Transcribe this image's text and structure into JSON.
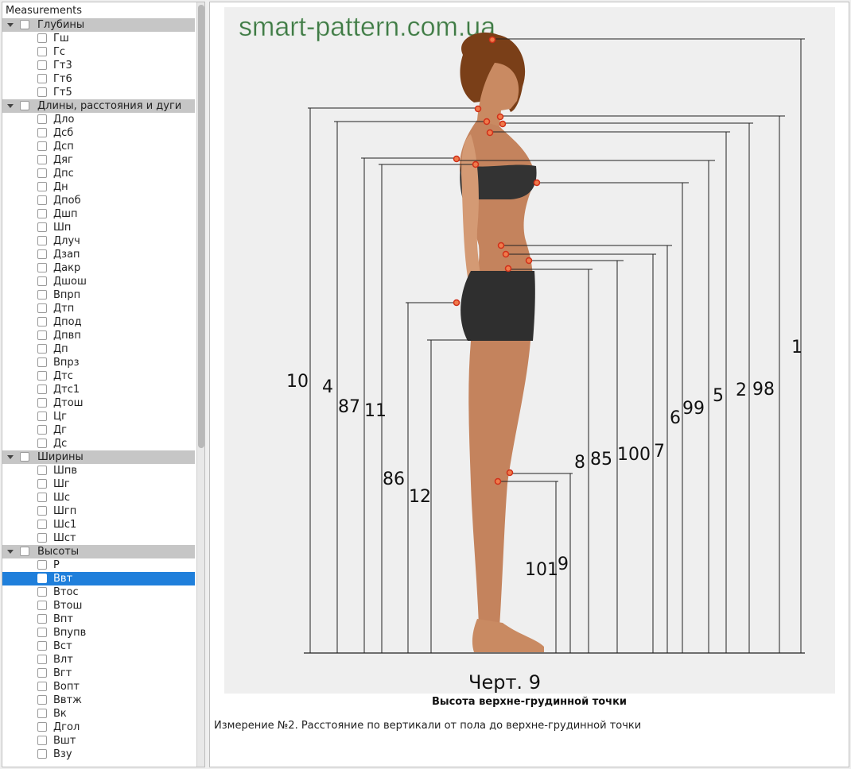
{
  "tree": {
    "header": "Measurements",
    "groups": [
      {
        "label": "Глубины",
        "items": [
          "Гш",
          "Гс",
          "Гт3",
          "Гт6",
          "Гт5"
        ]
      },
      {
        "label": "Длины, расстояния и дуги",
        "items": [
          "Дло",
          "Дсб",
          "Дсп",
          "Дяг",
          "Дпс",
          "Дн",
          "Дпоб",
          "Дшп",
          "Шп",
          "Длуч",
          "Дзап",
          "Дакр",
          "Дшош",
          "Впрп",
          "Дтп",
          "Дпод",
          "Дпвп",
          "Дп",
          "Впрз",
          "Дтс",
          "Дтс1",
          "Дтош",
          "Цг",
          "Дг",
          "Дс"
        ]
      },
      {
        "label": "Ширины",
        "items": [
          "Шпв",
          "Шг",
          "Шс",
          "Шгп",
          "Шс1",
          "Шст"
        ]
      },
      {
        "label": "Высоты",
        "items": [
          "Р",
          "Ввт",
          "Втос",
          "Втош",
          "Впт",
          "Впупв",
          "Вст",
          "Влт",
          "Вгт",
          "Вопт",
          "Ввтж",
          "Вк",
          "Дгол",
          "Вшт",
          "Взу"
        ]
      }
    ],
    "selected": "Ввт"
  },
  "figure": {
    "watermark": "smart-pattern.com.ua",
    "chart_label": "Черт. 9",
    "numbers": [
      "10",
      "4",
      "87",
      "11",
      "86",
      "12",
      "101",
      "9",
      "8",
      "85",
      "100",
      "7",
      "6",
      "99",
      "5",
      "2",
      "98",
      "1"
    ]
  },
  "caption": "Высота верхне-грудинной точки",
  "description": "Измерение №2. Расстояние по вертикали от пола до верхне-грудинной точки",
  "colors": {
    "selection": "#1f7fdb",
    "group_bg": "#c6c6c6",
    "point": "#e0401e",
    "watermark": "#3f7a45"
  }
}
